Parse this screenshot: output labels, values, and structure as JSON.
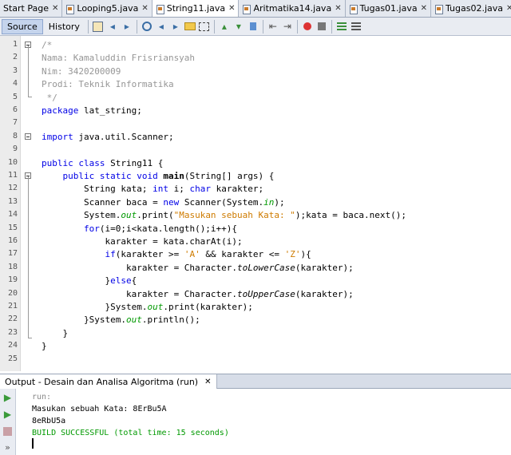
{
  "tabs": [
    {
      "label": "Start Page",
      "active": false,
      "has_icon": false
    },
    {
      "label": "Looping5.java",
      "active": false,
      "has_icon": true
    },
    {
      "label": "String11.java",
      "active": true,
      "has_icon": true
    },
    {
      "label": "Aritmatika14.java",
      "active": false,
      "has_icon": true
    },
    {
      "label": "Tugas01.java",
      "active": false,
      "has_icon": true
    },
    {
      "label": "Tugas02.java",
      "active": false,
      "has_icon": true
    }
  ],
  "tab_close_glyph": "✕",
  "toolbar": {
    "source_label": "Source",
    "history_label": "History"
  },
  "editor": {
    "lines": [
      {
        "n": "1",
        "html": "<span class=\"cm\">/*</span>"
      },
      {
        "n": "2",
        "html": "<span class=\"cm\">Nama: Kamaluddin Frisriansyah</span>"
      },
      {
        "n": "3",
        "html": "<span class=\"cm\">Nim: 3420200009</span>"
      },
      {
        "n": "4",
        "html": "<span class=\"cm\">Prodi: Teknik Informatika</span>"
      },
      {
        "n": "5",
        "html": "<span class=\"cm\"> */</span>"
      },
      {
        "n": "6",
        "html": "<span class=\"kw\">package</span> lat_string;"
      },
      {
        "n": "7",
        "html": ""
      },
      {
        "n": "8",
        "html": "<span class=\"kw\">import</span> java.util.Scanner;"
      },
      {
        "n": "9",
        "html": ""
      },
      {
        "n": "10",
        "html": "<span class=\"kw\">public class</span> String11 {"
      },
      {
        "n": "11",
        "html": "    <span class=\"kw\">public static void</span> <span class=\"bd\">main</span>(String[] args) {"
      },
      {
        "n": "12",
        "html": "        String kata; <span class=\"kw\">int</span> i; <span class=\"kw\">char</span> karakter;"
      },
      {
        "n": "13",
        "html": "        Scanner baca = <span class=\"kw\">new</span> Scanner(System.<span class=\"fld\">in</span>);"
      },
      {
        "n": "14",
        "html": "        System.<span class=\"fld\">out</span>.print(<span class=\"st\">\"Masukan sebuah Kata: \"</span>);kata = baca.next();"
      },
      {
        "n": "15",
        "html": "        <span class=\"kw\">for</span>(i=0;i&lt;kata.length();i++){"
      },
      {
        "n": "16",
        "html": "            karakter = kata.charAt(i);"
      },
      {
        "n": "17",
        "html": "            <span class=\"kw\">if</span>(karakter &gt;= <span class=\"st\">'A'</span> &amp;&amp; karakter &lt;= <span class=\"st\">'Z'</span>){"
      },
      {
        "n": "18",
        "html": "                karakter = Character.<span class=\"itl\">toLowerCase</span>(karakter);"
      },
      {
        "n": "19",
        "html": "            }<span class=\"kw\">else</span>{"
      },
      {
        "n": "20",
        "html": "                karakter = Character.<span class=\"itl\">toUpperCase</span>(karakter);"
      },
      {
        "n": "21",
        "html": "            }System.<span class=\"fld\">out</span>.print(karakter);"
      },
      {
        "n": "22",
        "html": "        }System.<span class=\"fld\">out</span>.println();"
      },
      {
        "n": "23",
        "html": "    }"
      },
      {
        "n": "24",
        "html": "}"
      },
      {
        "n": "25",
        "html": ""
      }
    ]
  },
  "output": {
    "title": "Output - Desain dan Analisa Algoritma (run)",
    "close_glyph": "✕",
    "lines": [
      {
        "text": "run:",
        "color": "#888888"
      },
      {
        "text": "Masukan sebuah Kata: 8ErBu5A",
        "color": "#000000"
      },
      {
        "text": "8eRbU5a",
        "color": "#000000"
      },
      {
        "text": "BUILD SUCCESSFUL (total time: 15 seconds)",
        "color": "#009900"
      }
    ]
  }
}
